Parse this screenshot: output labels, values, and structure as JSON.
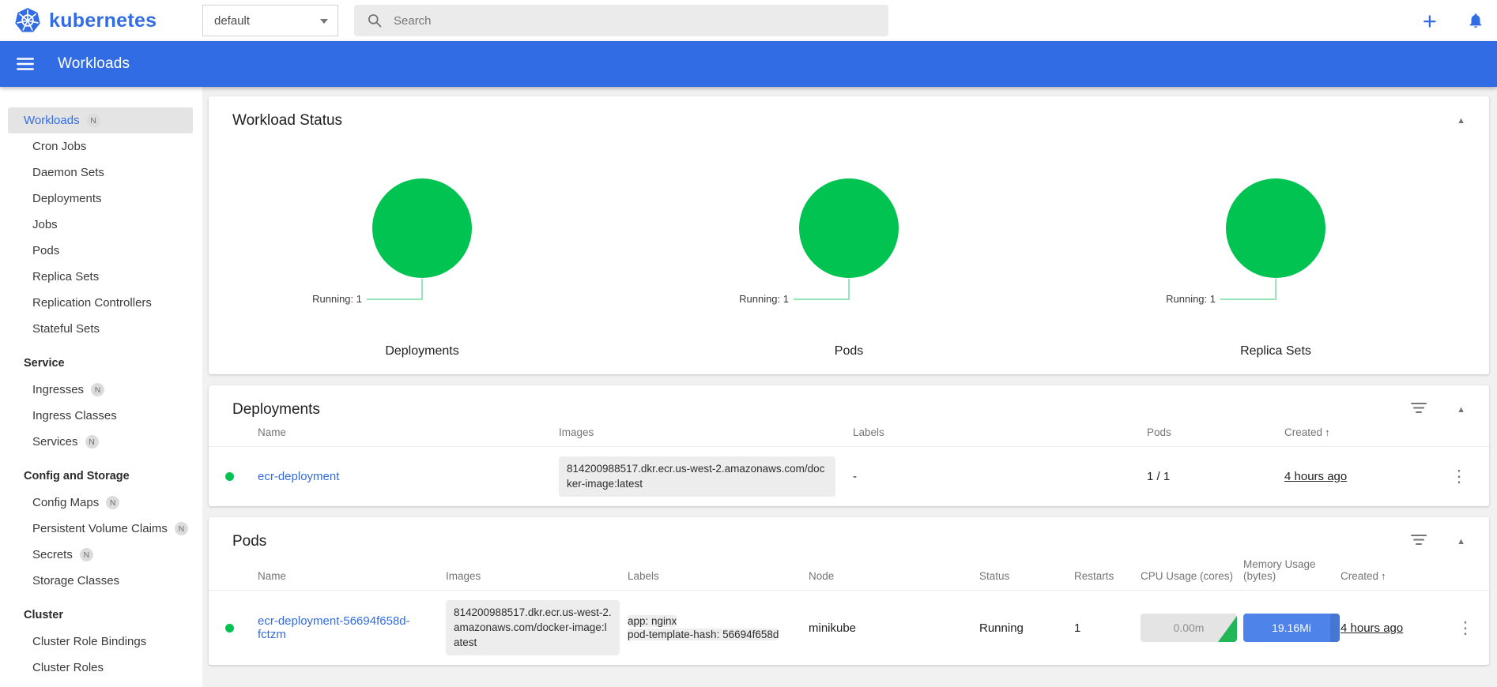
{
  "colors": {
    "primary_blue": "#326ce5",
    "status_green": "#00c352",
    "memory_bar_blue": "#4e83ea"
  },
  "topbar": {
    "brand": "kubernetes",
    "namespace_value": "default",
    "search_placeholder": "Search"
  },
  "appbar": {
    "title": "Workloads"
  },
  "icons": {
    "plus": "+",
    "collapse_arrow": "▲",
    "sort_arrow": "↑",
    "kebab": "⋮",
    "badge_letter": "N"
  },
  "sidebar": {
    "workloads": "Workloads",
    "groups": [
      {
        "items": [
          "Cron Jobs",
          "Daemon Sets",
          "Deployments",
          "Jobs",
          "Pods",
          "Replica Sets",
          "Replication Controllers",
          "Stateful Sets"
        ]
      },
      {
        "header": "Service",
        "items": [
          "Ingresses",
          "Ingress Classes",
          "Services"
        ]
      },
      {
        "header": "Config and Storage",
        "items": [
          "Config Maps",
          "Persistent Volume Claims",
          "Secrets",
          "Storage Classes"
        ]
      },
      {
        "header": "Cluster",
        "items": [
          "Cluster Role Bindings",
          "Cluster Roles"
        ]
      }
    ]
  },
  "workload_status": {
    "title": "Workload Status",
    "charts": [
      {
        "type": "pie",
        "title": "Deployments",
        "annotation": "Running: 1",
        "status": "Running",
        "count": 1,
        "fraction": 1.0
      },
      {
        "type": "pie",
        "title": "Pods",
        "annotation": "Running: 1",
        "status": "Running",
        "count": 1,
        "fraction": 1.0
      },
      {
        "type": "pie",
        "title": "Replica Sets",
        "annotation": "Running: 1",
        "status": "Running",
        "count": 1,
        "fraction": 1.0
      }
    ]
  },
  "deployments_card": {
    "title": "Deployments",
    "columns": {
      "name": "Name",
      "images": "Images",
      "labels": "Labels",
      "pods": "Pods",
      "created": "Created"
    },
    "row": {
      "name": "ecr-deployment",
      "image": "814200988517.dkr.ecr.us-west-2.amazonaws.com/docker-image:latest",
      "labels": "-",
      "pods": "1 / 1",
      "created": "4 hours ago"
    }
  },
  "pods_card": {
    "title": "Pods",
    "columns": {
      "name": "Name",
      "images": "Images",
      "labels": "Labels",
      "node": "Node",
      "status": "Status",
      "restarts": "Restarts",
      "cpu": "CPU Usage (cores)",
      "memory": "Memory Usage (bytes)",
      "created": "Created"
    },
    "row": {
      "name": "ecr-deployment-56694f658d-fctzm",
      "image": "814200988517.dkr.ecr.us-west-2.amazonaws.com/docker-image:latest",
      "labels": [
        "app: nginx",
        "pod-template-hash: 56694f658d"
      ],
      "node": "minikube",
      "status": "Running",
      "restarts": "1",
      "cpu": "0.00m",
      "memory": "19.16Mi",
      "created": "4 hours ago"
    }
  }
}
